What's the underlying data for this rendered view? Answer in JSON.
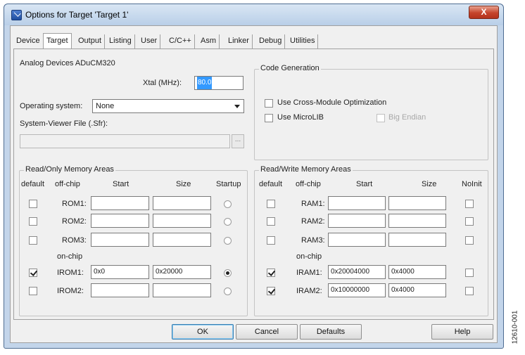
{
  "window": {
    "title": "Options for Target 'Target 1'",
    "close_label": "X"
  },
  "tabs": [
    {
      "label": "Device"
    },
    {
      "label": "Target",
      "active": true
    },
    {
      "label": "Output"
    },
    {
      "label": "Listing"
    },
    {
      "label": "User"
    },
    {
      "label": "C/C++"
    },
    {
      "label": "Asm"
    },
    {
      "label": "Linker"
    },
    {
      "label": "Debug"
    },
    {
      "label": "Utilities"
    }
  ],
  "target": {
    "device_name": "Analog Devices ADuCM320",
    "xtal_label": "Xtal (MHz):",
    "xtal_value": "80.0",
    "os_label": "Operating system:",
    "os_value": "None",
    "svf_label": "System-Viewer File (.Sfr):",
    "svf_value": "",
    "browse_label": "..."
  },
  "code_gen": {
    "title": "Code Generation",
    "cross_module_label": "Use Cross-Module Optimization",
    "cross_module_checked": false,
    "microlib_label": "Use MicroLIB",
    "microlib_checked": false,
    "big_endian_label": "Big Endian",
    "big_endian_checked": false,
    "big_endian_enabled": false
  },
  "rom": {
    "title": "Read/Only Memory Areas",
    "headers": {
      "default": "default",
      "offchip": "off-chip",
      "start": "Start",
      "size": "Size",
      "startup": "Startup"
    },
    "onchip_label": "on-chip",
    "rows": [
      {
        "name": "ROM1:",
        "default": false,
        "start": "",
        "size": "",
        "startup": false
      },
      {
        "name": "ROM2:",
        "default": false,
        "start": "",
        "size": "",
        "startup": false
      },
      {
        "name": "ROM3:",
        "default": false,
        "start": "",
        "size": "",
        "startup": false
      },
      {
        "name": "IROM1:",
        "default": true,
        "start": "0x0",
        "size": "0x20000",
        "startup": true
      },
      {
        "name": "IROM2:",
        "default": false,
        "start": "",
        "size": "",
        "startup": false
      }
    ]
  },
  "ram": {
    "title": "Read/Write Memory Areas",
    "headers": {
      "default": "default",
      "offchip": "off-chip",
      "start": "Start",
      "size": "Size",
      "noinit": "NoInit"
    },
    "onchip_label": "on-chip",
    "rows": [
      {
        "name": "RAM1:",
        "default": false,
        "start": "",
        "size": "",
        "noinit": false
      },
      {
        "name": "RAM2:",
        "default": false,
        "start": "",
        "size": "",
        "noinit": false
      },
      {
        "name": "RAM3:",
        "default": false,
        "start": "",
        "size": "",
        "noinit": false
      },
      {
        "name": "IRAM1:",
        "default": true,
        "start": "0x20004000",
        "size": "0x4000",
        "noinit": false
      },
      {
        "name": "IRAM2:",
        "default": true,
        "start": "0x10000000",
        "size": "0x4000",
        "noinit": false
      }
    ]
  },
  "buttons": {
    "ok": "OK",
    "cancel": "Cancel",
    "defaults": "Defaults",
    "help": "Help"
  },
  "figure_id": "12610-001"
}
